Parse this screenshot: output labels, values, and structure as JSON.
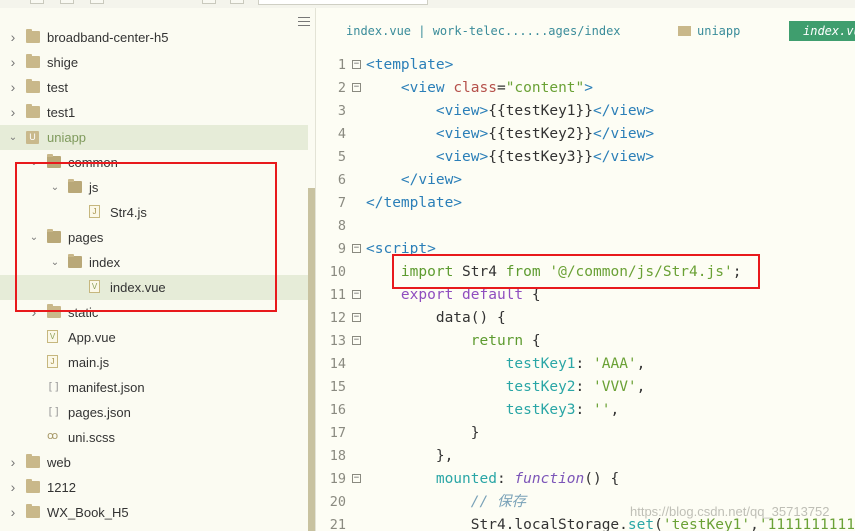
{
  "sidebar": {
    "items": [
      {
        "label": "broadband-center-h5",
        "type": "folder",
        "expanded": false,
        "active": false
      },
      {
        "label": "shige",
        "type": "folder",
        "expanded": false,
        "active": false
      },
      {
        "label": "test",
        "type": "folder",
        "expanded": false,
        "active": false
      },
      {
        "label": "test1",
        "type": "folder",
        "expanded": false,
        "active": false
      },
      {
        "label": "uniapp",
        "type": "project",
        "expanded": true,
        "active": true
      },
      {
        "label": "common",
        "type": "folder",
        "expanded": true,
        "active": false
      },
      {
        "label": "js",
        "type": "folder",
        "expanded": true,
        "active": false
      },
      {
        "label": "Str4.js",
        "type": "file-js",
        "active": false
      },
      {
        "label": "pages",
        "type": "folder",
        "expanded": true,
        "active": false
      },
      {
        "label": "index",
        "type": "folder",
        "expanded": true,
        "active": false
      },
      {
        "label": "index.vue",
        "type": "file-vue",
        "active": true
      },
      {
        "label": "static",
        "type": "folder",
        "expanded": false,
        "active": false
      },
      {
        "label": "App.vue",
        "type": "file-vue",
        "active": false
      },
      {
        "label": "main.js",
        "type": "file-js",
        "active": false
      },
      {
        "label": "manifest.json",
        "type": "file-json",
        "active": false
      },
      {
        "label": "pages.json",
        "type": "file-json",
        "active": false
      },
      {
        "label": "uni.scss",
        "type": "file-scss",
        "active": false
      },
      {
        "label": "web",
        "type": "folder",
        "expanded": false,
        "active": false
      },
      {
        "label": "1212",
        "type": "folder",
        "expanded": false,
        "active": false
      },
      {
        "label": "WX_Book_H5",
        "type": "folder",
        "expanded": false,
        "active": false
      }
    ]
  },
  "editor": {
    "breadcrumb": "index.vue | work-telec......ages/index",
    "folder_tab": "uniapp",
    "active_tab": "index.vue",
    "lines": [
      {
        "n": "1",
        "fold": "⊟",
        "tokens": [
          [
            "tag",
            "<template>"
          ]
        ]
      },
      {
        "n": "2",
        "fold": "⊟",
        "tokens": [
          [
            "plain",
            "    "
          ],
          [
            "tag",
            "<view "
          ],
          [
            "attr",
            "class"
          ],
          [
            "plain",
            "="
          ],
          [
            "str",
            "\"content\""
          ],
          [
            "tag",
            ">"
          ]
        ]
      },
      {
        "n": "3",
        "fold": "",
        "tokens": [
          [
            "plain",
            "        "
          ],
          [
            "tag",
            "<view>"
          ],
          [
            "plain",
            "{{testKey1}}"
          ],
          [
            "tag",
            "</view>"
          ]
        ]
      },
      {
        "n": "4",
        "fold": "",
        "tokens": [
          [
            "plain",
            "        "
          ],
          [
            "tag",
            "<view>"
          ],
          [
            "plain",
            "{{testKey2}}"
          ],
          [
            "tag",
            "</view>"
          ]
        ]
      },
      {
        "n": "5",
        "fold": "",
        "tokens": [
          [
            "plain",
            "        "
          ],
          [
            "tag",
            "<view>"
          ],
          [
            "plain",
            "{{testKey3}}"
          ],
          [
            "tag",
            "</view>"
          ]
        ]
      },
      {
        "n": "6",
        "fold": "",
        "tokens": [
          [
            "plain",
            "    "
          ],
          [
            "tag",
            "</view>"
          ]
        ]
      },
      {
        "n": "7",
        "fold": "",
        "tokens": [
          [
            "tag",
            "</template>"
          ]
        ]
      },
      {
        "n": "8",
        "fold": "",
        "tokens": []
      },
      {
        "n": "9",
        "fold": "⊟",
        "tokens": [
          [
            "tag",
            "<script>"
          ]
        ]
      },
      {
        "n": "10",
        "fold": "",
        "tokens": [
          [
            "plain",
            "    "
          ],
          [
            "kw",
            "import"
          ],
          [
            "plain",
            " Str4 "
          ],
          [
            "kw",
            "from"
          ],
          [
            "plain",
            " "
          ],
          [
            "str",
            "'@/common/js/Str4.js'"
          ],
          [
            "plain",
            ";"
          ]
        ]
      },
      {
        "n": "11",
        "fold": "⊟",
        "tokens": [
          [
            "plain",
            "    "
          ],
          [
            "kw2",
            "export default"
          ],
          [
            "plain",
            " {"
          ]
        ]
      },
      {
        "n": "12",
        "fold": "⊟",
        "tokens": [
          [
            "plain",
            "        data() {"
          ]
        ]
      },
      {
        "n": "13",
        "fold": "⊟",
        "tokens": [
          [
            "plain",
            "            "
          ],
          [
            "kw",
            "return"
          ],
          [
            "plain",
            " {"
          ]
        ]
      },
      {
        "n": "14",
        "fold": "",
        "tokens": [
          [
            "plain",
            "                "
          ],
          [
            "prop",
            "testKey1"
          ],
          [
            "plain",
            ": "
          ],
          [
            "str",
            "'AAA'"
          ],
          [
            "plain",
            ","
          ]
        ]
      },
      {
        "n": "15",
        "fold": "",
        "tokens": [
          [
            "plain",
            "                "
          ],
          [
            "prop",
            "testKey2"
          ],
          [
            "plain",
            ": "
          ],
          [
            "str",
            "'VVV'"
          ],
          [
            "plain",
            ","
          ]
        ]
      },
      {
        "n": "16",
        "fold": "",
        "tokens": [
          [
            "plain",
            "                "
          ],
          [
            "prop",
            "testKey3"
          ],
          [
            "plain",
            ": "
          ],
          [
            "str",
            "''"
          ],
          [
            "plain",
            ","
          ]
        ]
      },
      {
        "n": "17",
        "fold": "",
        "tokens": [
          [
            "plain",
            "            }"
          ]
        ]
      },
      {
        "n": "18",
        "fold": "",
        "tokens": [
          [
            "plain",
            "        },"
          ]
        ]
      },
      {
        "n": "19",
        "fold": "⊟",
        "tokens": [
          [
            "plain",
            "        "
          ],
          [
            "prop",
            "mounted"
          ],
          [
            "plain",
            ": "
          ],
          [
            "fn",
            "function"
          ],
          [
            "plain",
            "() {"
          ]
        ]
      },
      {
        "n": "20",
        "fold": "",
        "tokens": [
          [
            "plain",
            "            "
          ],
          [
            "cmt",
            "// 保存"
          ]
        ]
      },
      {
        "n": "21",
        "fold": "",
        "tokens": [
          [
            "plain",
            "            Str4.localStorage."
          ],
          [
            "prop",
            "set"
          ],
          [
            "plain",
            "("
          ],
          [
            "str",
            "'testKey1'"
          ],
          [
            "plain",
            ","
          ],
          [
            "str",
            "'1111111111"
          ]
        ]
      }
    ]
  },
  "watermark": "https://blog.csdn.net/qq_35713752"
}
